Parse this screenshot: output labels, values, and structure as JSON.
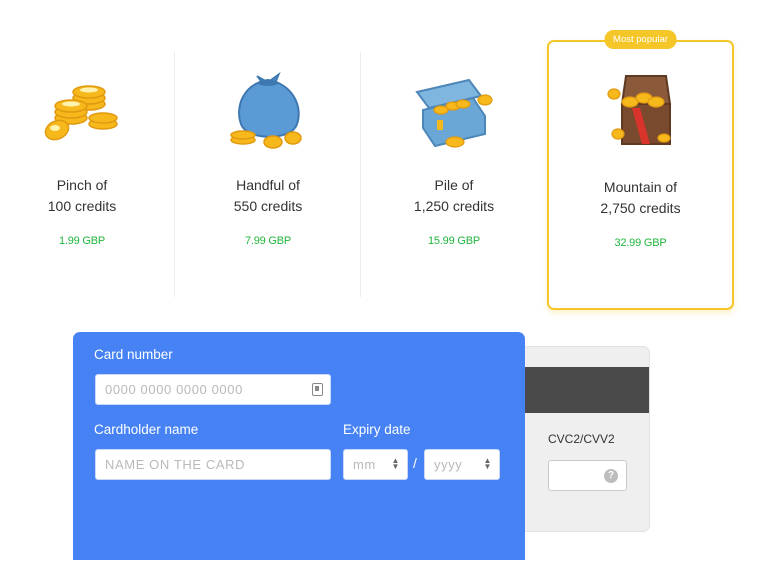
{
  "packages": [
    {
      "title": "Pinch of",
      "amount": "100 credits",
      "price": "1.99 GBP",
      "icon": "coin-stack-icon"
    },
    {
      "title": "Handful of",
      "amount": "550 credits",
      "price": "7.99 GBP",
      "icon": "coin-bag-icon"
    },
    {
      "title": "Pile of",
      "amount": "1,250 credits",
      "price": "15.99 GBP",
      "icon": "coin-chest-icon"
    },
    {
      "title": "Mountain of",
      "amount": "2,750 credits",
      "price": "32.99 GBP",
      "icon": "treasure-chest-icon",
      "badge": "Most popular",
      "selected": true
    }
  ],
  "card_form": {
    "card_number_label": "Card number",
    "card_number_placeholder": "0000 0000 0000 0000",
    "cardholder_label": "Cardholder name",
    "cardholder_placeholder": "NAME ON THE CARD",
    "expiry_label": "Expiry date",
    "month_placeholder": "mm",
    "year_placeholder": "yyyy",
    "separator": "/",
    "cvv_label": "CVC2/CVV2",
    "cvv_help": "?"
  },
  "colors": {
    "accent_blue": "#4682f4",
    "price_green": "#21b53d",
    "popular_gold": "#f5c628"
  }
}
